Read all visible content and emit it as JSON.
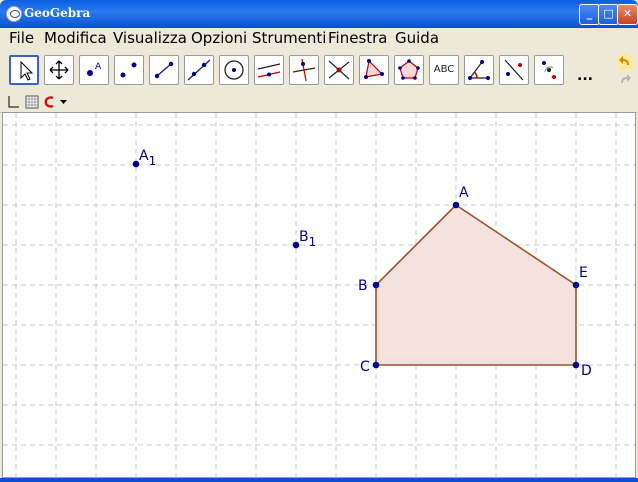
{
  "window": {
    "title": "GeoGebra"
  },
  "menu": [
    "File",
    "Modifica",
    "Visualizza",
    "Opzioni",
    "Strumenti",
    "Finestra",
    "Guida"
  ],
  "toolbar": {
    "tools": [
      {
        "icon": "pointer-icon",
        "active": true
      },
      {
        "icon": "move-view-icon"
      },
      {
        "icon": "new-point-icon"
      },
      {
        "icon": "two-points-icon"
      },
      {
        "icon": "segment-icon"
      },
      {
        "icon": "line-icon"
      },
      {
        "icon": "circle-center-point-icon"
      },
      {
        "icon": "parallel-line-icon"
      },
      {
        "icon": "perpendicular-line-icon"
      },
      {
        "icon": "intersect-icon"
      },
      {
        "icon": "polygon-icon"
      },
      {
        "icon": "regular-polygon-icon"
      },
      {
        "icon": "text-tool-icon",
        "label": "ABC"
      },
      {
        "icon": "angle-icon"
      },
      {
        "icon": "reflect-line-icon"
      },
      {
        "icon": "reflect-point-icon"
      }
    ],
    "more_label": "..."
  },
  "colors": {
    "point": "#00008b",
    "polygon_stroke": "#a0522d",
    "polygon_fill": "#f3e2dd",
    "grid": "#c8c8c8"
  },
  "graphics": {
    "points": [
      {
        "label": "A",
        "sub": "1"
      },
      {
        "label": "B",
        "sub": "1"
      },
      {
        "label": "A"
      },
      {
        "label": "B"
      },
      {
        "label": "C"
      },
      {
        "label": "D"
      },
      {
        "label": "E"
      }
    ]
  }
}
